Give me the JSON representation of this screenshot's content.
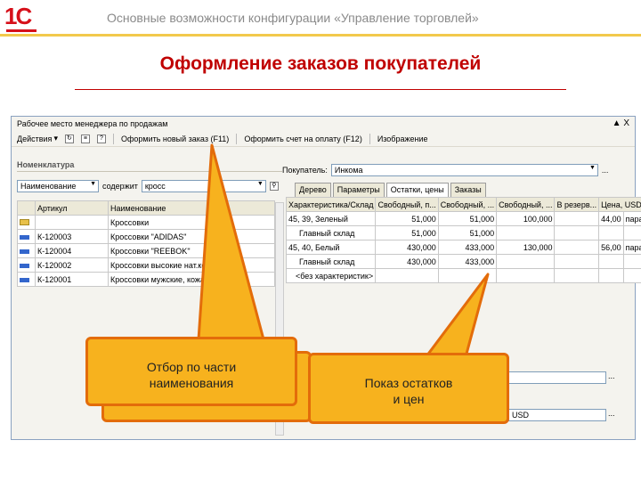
{
  "logo": "1С",
  "header": "Основные возможности конфигурации «Управление торговлей»",
  "title": "Оформление заказов покупателей",
  "window": {
    "title": "Рабочее место менеджера по продажам",
    "close": "X",
    "toolbar": {
      "actions": "Действия",
      "order": "Оформить новый заказ (F11)",
      "invoice": "Оформить счет на оплату (F12)",
      "image": "Изображение"
    }
  },
  "left": {
    "group": "Номенклатура",
    "filter_field": "Наименование",
    "filter_mode": "содержит",
    "filter_value": "кросс",
    "columns": [
      "Артикул",
      "Наименование"
    ],
    "rows": [
      [
        "",
        "Кроссовки"
      ],
      [
        "К-120003",
        "Кроссовки \"ADIDAS\""
      ],
      [
        "К-120004",
        "Кроссовки \"REEBOK\""
      ],
      [
        "К-120002",
        "Кроссовки высокие нат.кожа"
      ],
      [
        "К-120001",
        "Кроссовки мужские, кожа"
      ]
    ]
  },
  "right": {
    "buyer_label": "Покупатель:",
    "buyer_value": "Инкома",
    "tabs": [
      "Дерево",
      "Параметры",
      "Остатки, цены",
      "Заказы"
    ],
    "columns": [
      "Характеристика/Склад",
      "Свободный, п...",
      "Свободный, ...",
      "Свободный, ...",
      "В резерв...",
      "Цена, USD"
    ],
    "rows": [
      [
        "45, 39, Зеленый",
        "51,000",
        "51,000",
        "100,000",
        "",
        "44,00",
        "пара"
      ],
      [
        "Главный склад",
        "51,000",
        "51,000",
        "",
        "",
        "",
        ""
      ],
      [
        "45, 40, Белый",
        "430,000",
        "433,000",
        "130,000",
        "",
        "56,00",
        "пара"
      ],
      [
        "Главный склад",
        "430,000",
        "433,000",
        "",
        "",
        "",
        ""
      ],
      [
        "<без характеристик>",
        "",
        "",
        "",
        "",
        "",
        ""
      ]
    ],
    "currency": "USD",
    "more": "..."
  },
  "callouts": {
    "filter": "Отбор по части\nнаименования",
    "stock": "Показ остатков\nи цен"
  }
}
